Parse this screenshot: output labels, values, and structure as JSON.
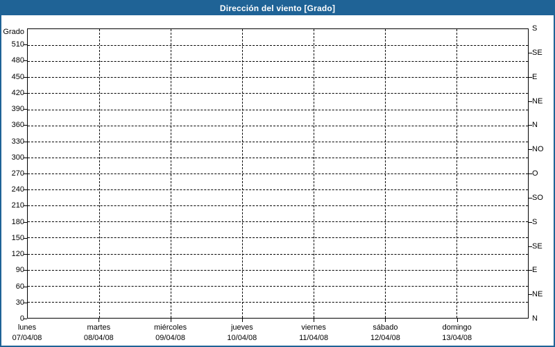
{
  "title": "Dirección del viento [Grado]",
  "colors": {
    "accent": "#1f6396",
    "plot_border": "#000000",
    "grid": "#000000",
    "text": "#000000",
    "title_text": "#ffffff",
    "background": "#ffffff"
  },
  "chart_data": {
    "type": "line",
    "title": "Dirección del viento [Grado]",
    "ylabel": "Grado",
    "xlabel": "",
    "ylim": [
      0,
      540
    ],
    "y_ticks": [
      510,
      480,
      450,
      420,
      390,
      360,
      330,
      300,
      270,
      240,
      210,
      180,
      150,
      120,
      90,
      60,
      30,
      0
    ],
    "y_tick_step": 30,
    "right_axis_ticks": [
      {
        "deg": 540,
        "label": "S"
      },
      {
        "deg": 495,
        "label": "SE"
      },
      {
        "deg": 450,
        "label": "E"
      },
      {
        "deg": 405,
        "label": "NE"
      },
      {
        "deg": 360,
        "label": "N"
      },
      {
        "deg": 315,
        "label": "NO"
      },
      {
        "deg": 270,
        "label": "O"
      },
      {
        "deg": 225,
        "label": "SO"
      },
      {
        "deg": 180,
        "label": "S"
      },
      {
        "deg": 135,
        "label": "SE"
      },
      {
        "deg": 90,
        "label": "E"
      },
      {
        "deg": 45,
        "label": "NE"
      },
      {
        "deg": 0,
        "label": "N"
      }
    ],
    "x_categories": [
      {
        "day": "lunes",
        "date": "07/04/08"
      },
      {
        "day": "martes",
        "date": "08/04/08"
      },
      {
        "day": "miércoles",
        "date": "09/04/08"
      },
      {
        "day": "jueves",
        "date": "10/04/08"
      },
      {
        "day": "viernes",
        "date": "11/04/08"
      },
      {
        "day": "sábado",
        "date": "12/04/08"
      },
      {
        "day": "domingo",
        "date": "13/04/08"
      }
    ],
    "grid": "dashed-both-axes",
    "legend_position": "none",
    "series": []
  }
}
